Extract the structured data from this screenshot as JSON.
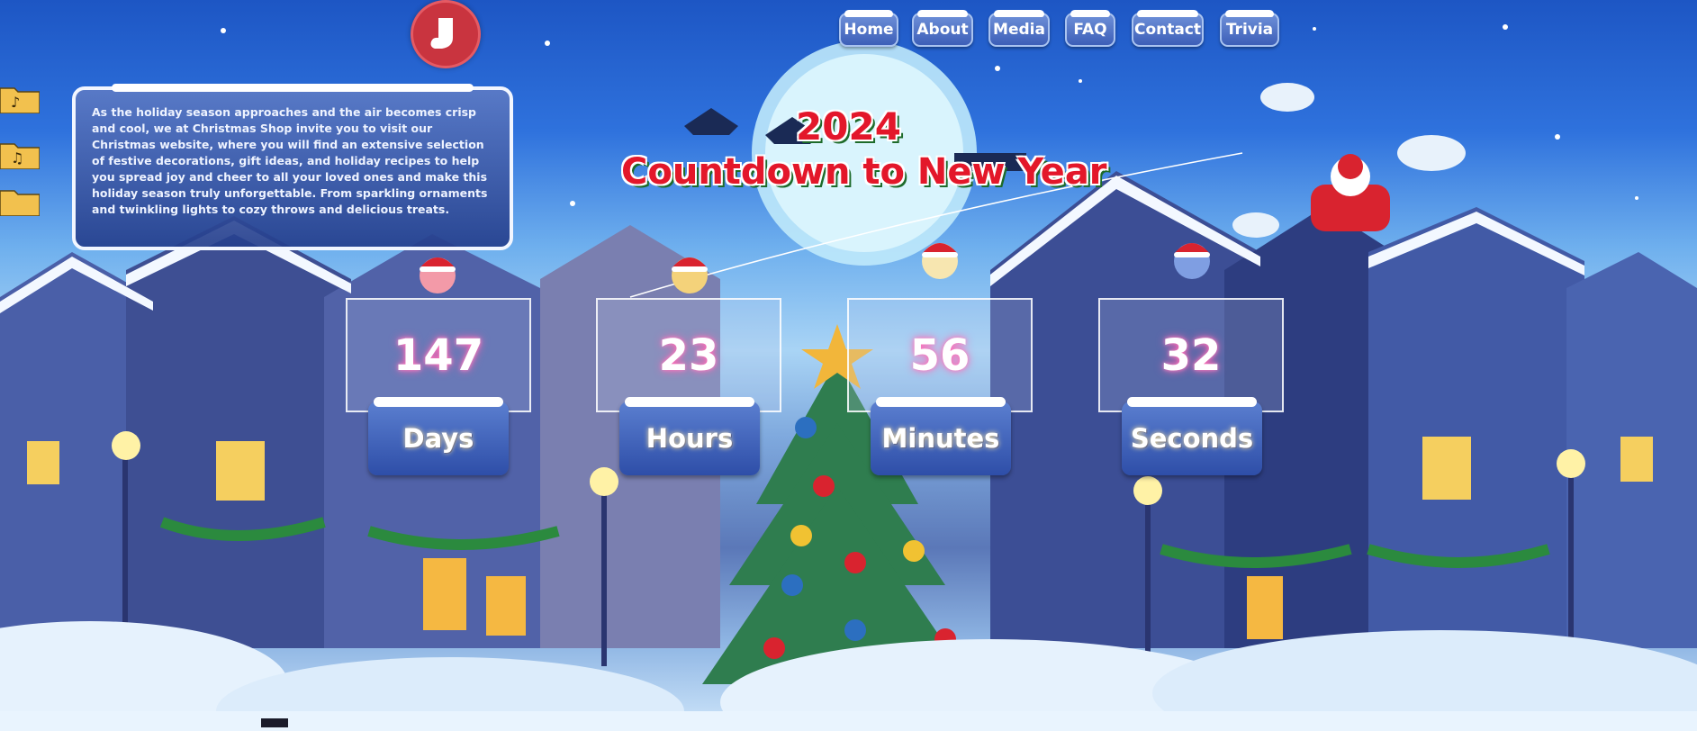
{
  "nav": {
    "items": [
      {
        "label": "Home"
      },
      {
        "label": "About"
      },
      {
        "label": "Media"
      },
      {
        "label": "FAQ"
      },
      {
        "label": "Contact"
      },
      {
        "label": "Trivia"
      }
    ]
  },
  "info": {
    "text": "As the holiday season approaches and the air becomes crisp and cool, we at Christmas Shop invite you to visit our Christmas website, where you will find an extensive selection of festive decorations, gift ideas, and holiday recipes to help you spread joy and cheer to all your loved ones and make this holiday season truly unforgettable. From sparkling ornaments and twinkling lights to cozy throws and delicious treats."
  },
  "hero": {
    "year": "2024",
    "title": "Countdown to New Year"
  },
  "countdown": {
    "days": {
      "value": "147",
      "label": "Days"
    },
    "hours": {
      "value": "23",
      "label": "Hours"
    },
    "minutes": {
      "value": "56",
      "label": "Minutes"
    },
    "seconds": {
      "value": "32",
      "label": "Seconds"
    }
  },
  "icons": {
    "logo": "stocking-icon",
    "music": "music-folder-icon",
    "characters": [
      "santa-emoji-icon",
      "santa-emoji-icon",
      "santa-emoji-icon",
      "santa-emoji-icon"
    ]
  },
  "colors": {
    "title_red": "#e3172a",
    "title_shadow_green": "#1d6b2a",
    "nav_blue": "#3d5fb8",
    "glow_pink": "#ff5fb0"
  }
}
